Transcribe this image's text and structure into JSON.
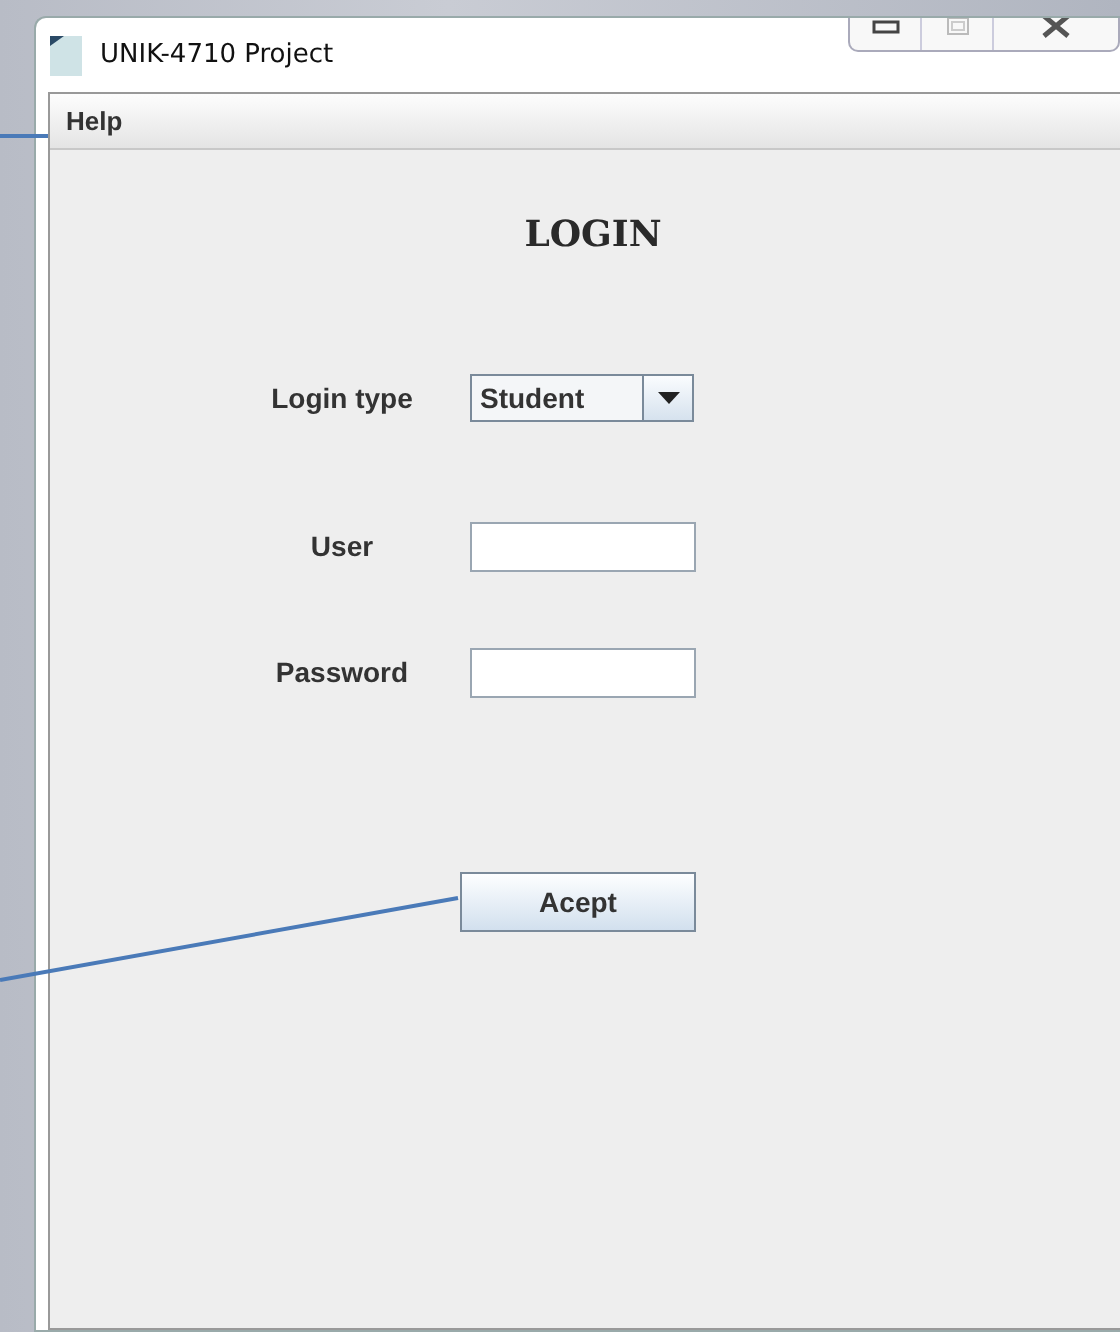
{
  "window": {
    "title": "UNIK-4710 Project"
  },
  "menu": [
    {
      "label": "Help"
    }
  ],
  "heading": "LOGIN",
  "fields": [
    {
      "kind": "dropdown",
      "label": "Login type",
      "value": "Student"
    },
    {
      "kind": "text",
      "label": "User"
    },
    {
      "kind": "password",
      "label": "Password"
    }
  ],
  "buttons": [
    {
      "label": "Acept"
    }
  ]
}
